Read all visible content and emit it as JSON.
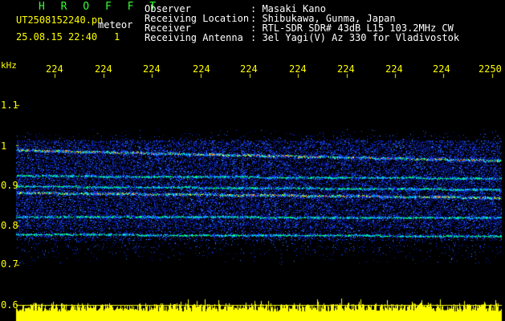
{
  "header": {
    "app_name": "H R O F F T",
    "filename": "UT2508152240.pn",
    "meteor_label": "meteor",
    "datetime": "25.08.15 22:40",
    "count": "1",
    "fields": [
      {
        "label": "Observer",
        "value": ": Masaki Kano"
      },
      {
        "label": "Receiving Location",
        "value": ": Shibukawa, Gunma, Japan"
      },
      {
        "label": "Receiver",
        "value": ": RTL-SDR SDR# 43dB L15 103.2MHz CW"
      },
      {
        "label": "Receiving Antenna",
        "value": ": 3el Yagi(V) Az 330 for Vladivostok"
      }
    ]
  },
  "axis": {
    "unit": "kHz",
    "time_ticks": [
      "224",
      "224",
      "224",
      "224",
      "224",
      "224",
      "224",
      "224",
      "224",
      "2250"
    ],
    "freq_ticks": [
      "1.1",
      "1",
      "0.9",
      "0.8",
      "0.7",
      "0.6"
    ]
  },
  "colors": {
    "yellow": "#ffff00",
    "green": "#33ff33",
    "header_text": "#ffffff",
    "background": "#000000"
  }
}
